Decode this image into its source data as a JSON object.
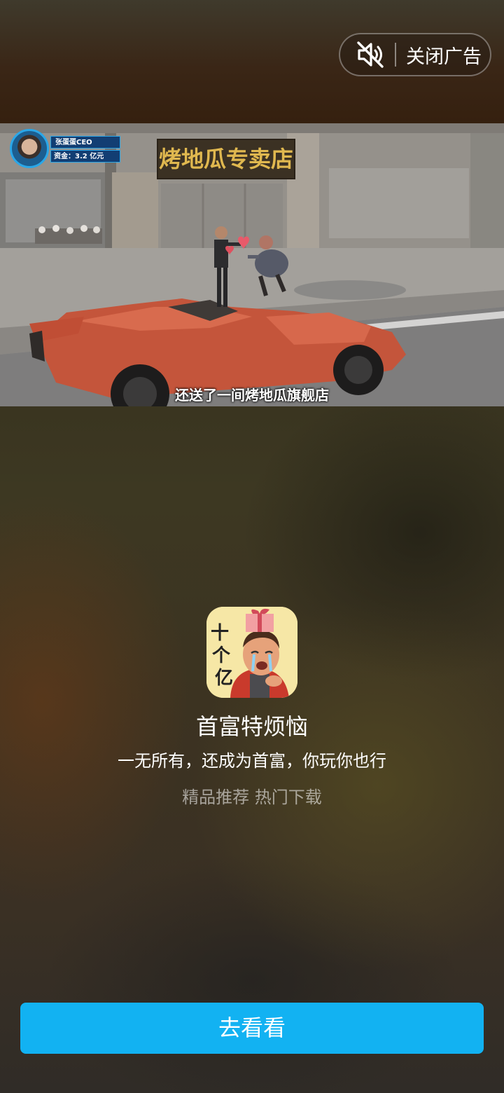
{
  "ad_controls": {
    "close_label": "关闭广告",
    "mute_icon": "sound-muted-icon"
  },
  "video": {
    "hud": {
      "name": "张蛋蛋CEO",
      "funds": "资金：3.2 亿元"
    },
    "shop_sign": "烤地瓜专卖店",
    "subtitle": "还送了一间烤地瓜旗舰店"
  },
  "app": {
    "icon_text": "十个亿",
    "name": "首富特烦恼",
    "description": "一无所有，还成为首富，你玩你也行",
    "tagline": "精品推荐 热门下载"
  },
  "cta": {
    "label": "去看看",
    "color": "#12b2f2"
  }
}
